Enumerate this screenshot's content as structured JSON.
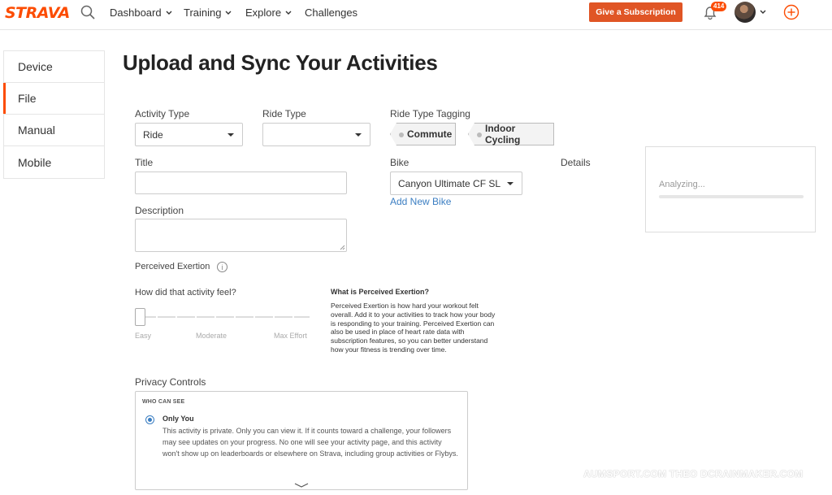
{
  "nav": {
    "logo": "STRAVA",
    "dashboard": "Dashboard",
    "training": "Training",
    "explore": "Explore",
    "challenges": "Challenges",
    "subscription_button": "Give a Subscription",
    "notifications_count": "414"
  },
  "sidebar": {
    "items": [
      {
        "label": "Device"
      },
      {
        "label": "File"
      },
      {
        "label": "Manual"
      },
      {
        "label": "Mobile"
      }
    ]
  },
  "page": {
    "title": "Upload and Sync Your Activities"
  },
  "form": {
    "activity_type_label": "Activity Type",
    "activity_type_value": "Ride",
    "ride_type_label": "Ride Type",
    "ride_type_value": "",
    "ride_type_tagging_label": "Ride Type Tagging",
    "tags": [
      "Commute",
      "Indoor Cycling"
    ],
    "title_label": "Title",
    "bike_label": "Bike",
    "bike_value": "Canyon Ultimate CF SL",
    "add_bike_link": "Add New Bike",
    "details_label": "Details",
    "analyzing_text": "Analyzing...",
    "description_label": "Description",
    "perceived_exertion_label": "Perceived Exertion",
    "feel_question": "How did that activity feel?",
    "slider_labels": [
      "Easy",
      "Moderate",
      "Max Effort"
    ],
    "pe_info_title": "What is Perceived Exertion?",
    "pe_info_text": "Perceived Exertion is how hard your workout felt overall. Add it to your activities to track how your body is responding to your training. Perceived Exertion can also be used in place of heart rate data with subscription features, so you can better understand how your fitness is trending over time."
  },
  "privacy": {
    "label": "Privacy Controls",
    "who_can_see": "WHO CAN SEE",
    "option_title": "Only You",
    "option_text": "This activity is private. Only you can view it. If it counts toward a challenge, your followers may see updates on your progress. No one will see your activity page, and this activity won't show up on leaderboards or elsewhere on Strava, including group activities or Flybys."
  },
  "watermark": "AUMSPORT.COM THEO DCRAINMAKER.COM",
  "colors": {
    "brand": "#fc4c02",
    "button": "#e05525",
    "link": "#3b7ec2"
  }
}
